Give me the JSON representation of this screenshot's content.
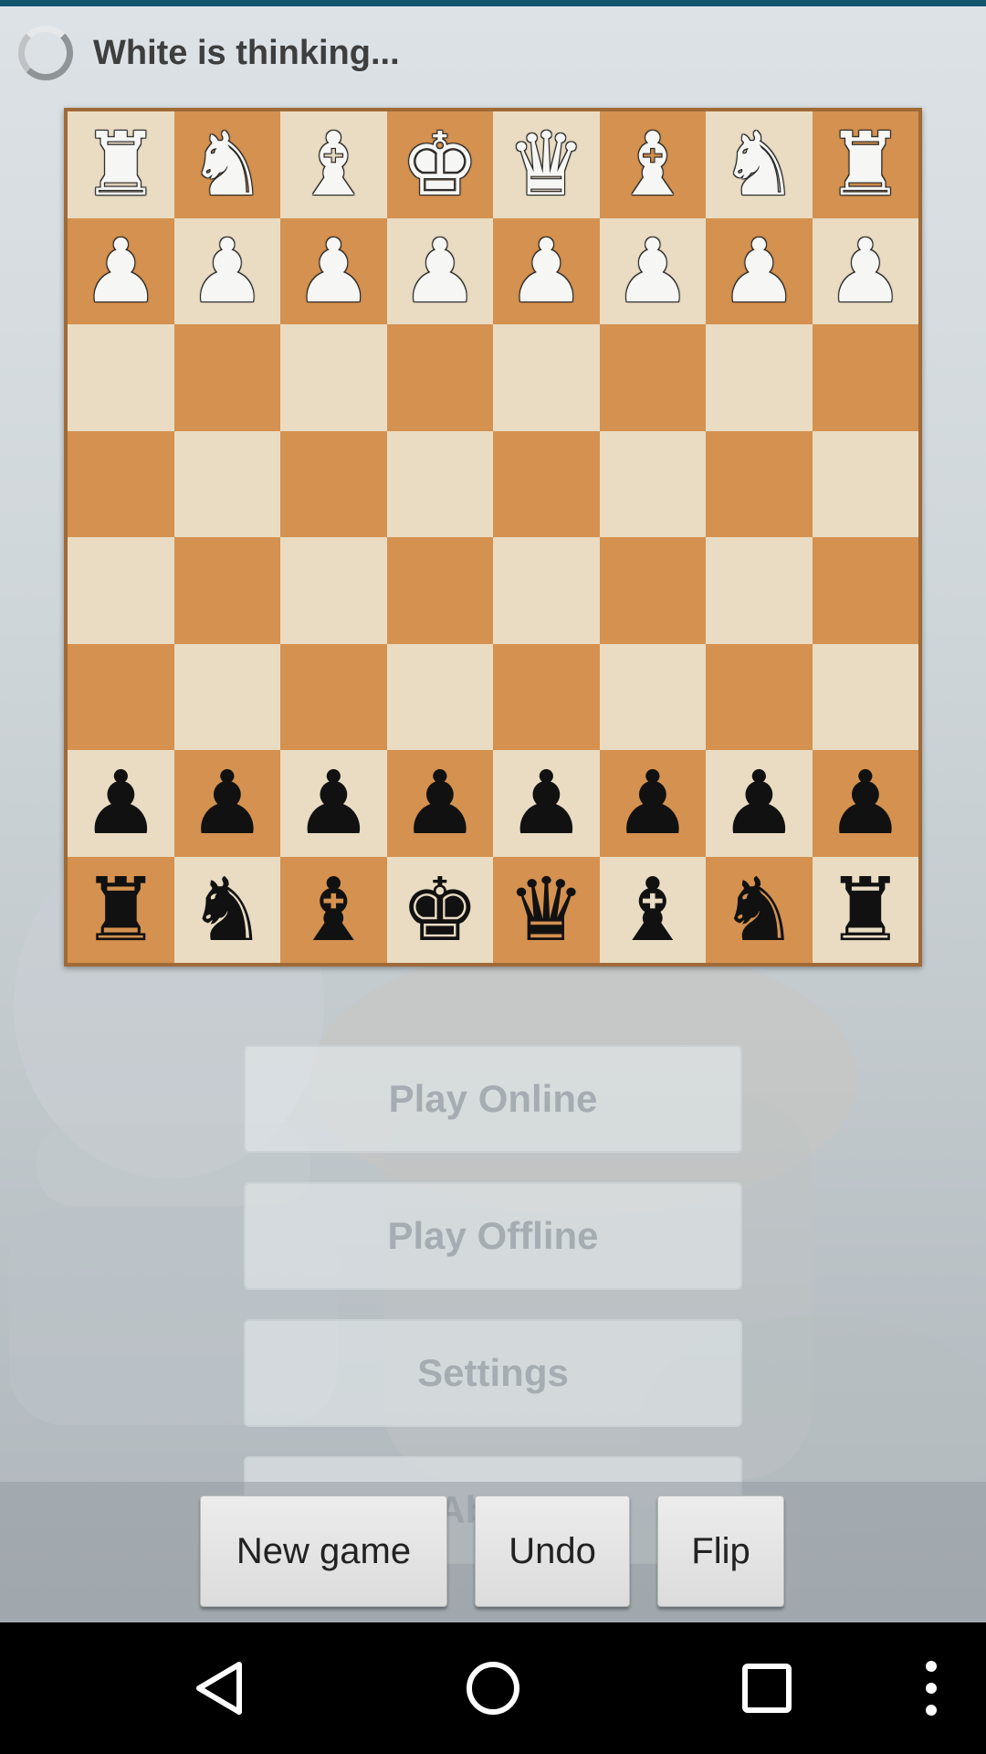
{
  "status": {
    "text": "White is thinking...",
    "spinner_icon": "spinner-icon"
  },
  "board": {
    "colors": {
      "light": "#e9dcc3",
      "dark": "#d4914f",
      "frame": "#a06a37"
    },
    "ranks": [
      [
        "R",
        "N",
        "B",
        "K",
        "Q",
        "B",
        "N",
        "R"
      ],
      [
        "P",
        "P",
        "P",
        "P",
        "P",
        "P",
        "P",
        "P"
      ],
      [
        "",
        "",
        "",
        "",
        "",
        "",
        "",
        ""
      ],
      [
        "",
        "",
        "",
        "",
        "",
        "",
        "",
        ""
      ],
      [
        "",
        "",
        "",
        "",
        "",
        "",
        "",
        ""
      ],
      [
        "",
        "",
        "",
        "",
        "",
        "",
        "",
        ""
      ],
      [
        "p",
        "p",
        "p",
        "p",
        "p",
        "p",
        "p",
        "p"
      ],
      [
        "r",
        "n",
        "b",
        "k",
        "q",
        "b",
        "n",
        "r"
      ]
    ],
    "glyphs": {
      "R": "♜",
      "N": "♞",
      "B": "♝",
      "Q": "♛",
      "K": "♚",
      "P": "♟",
      "r": "♜",
      "n": "♞",
      "b": "♝",
      "q": "♛",
      "k": "♚",
      "p": "♟"
    }
  },
  "menu": {
    "play_online": "Play Online",
    "play_offline": "Play Offline",
    "settings": "Settings",
    "about": "About"
  },
  "toolbar": {
    "new_game": "New game",
    "undo": "Undo",
    "flip": "Flip"
  },
  "navbar": {
    "back_icon": "back-triangle-icon",
    "home_icon": "home-circle-icon",
    "recents_icon": "recents-square-icon",
    "overflow_icon": "overflow-dots-icon"
  }
}
